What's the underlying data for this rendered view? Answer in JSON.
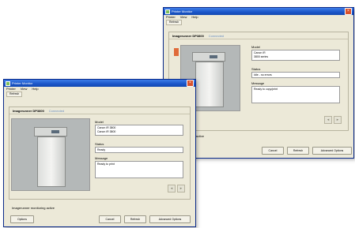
{
  "back_window": {
    "title": "Printer Monitor",
    "close_glyph": "×",
    "menu": [
      "Printer",
      "View",
      "Help"
    ],
    "toolbar_label": "Refresh",
    "model": "Imagerunner DP3800",
    "status": "Connected",
    "field1_label": "Model",
    "field1_lines": [
      "Canon iR",
      "3800 series"
    ],
    "field2_label": "Status",
    "field2_value": "Idle - no errors",
    "field3_label": "Message",
    "field3_value": "Ready to copy/print",
    "arrow_left": "◂",
    "arrow_right": "▸",
    "bottom_text": "Printer monitoring active",
    "buttons": [
      "Cancel",
      "Refresh",
      "Advanced Options"
    ]
  },
  "front_window": {
    "title": "Printer Monitor",
    "close_glyph": "×",
    "menu": [
      "Printer",
      "View",
      "Help"
    ],
    "toolbar_label": "Refresh",
    "model": "Imagerunner DP3800",
    "status": "Connected",
    "field1_label": "Model",
    "field1_lines": [
      "Canon iR 3800",
      "Canon iR 3800"
    ],
    "field2_label": "Status",
    "field2_value": "Ready",
    "field3_label": "Message",
    "field3_value": "Ready to print",
    "arrow_left": "◂",
    "arrow_right": "▸",
    "bottom_text": "Imagerunner monitoring active",
    "left_button": "Options",
    "buttons": [
      "Cancel",
      "Refresh",
      "Advanced Options"
    ]
  },
  "colors": {
    "titlebar": "#1a55c8",
    "window_bg": "#ece9d8",
    "status_accent": "#6b8fc0",
    "alert": "#e06b3a"
  }
}
